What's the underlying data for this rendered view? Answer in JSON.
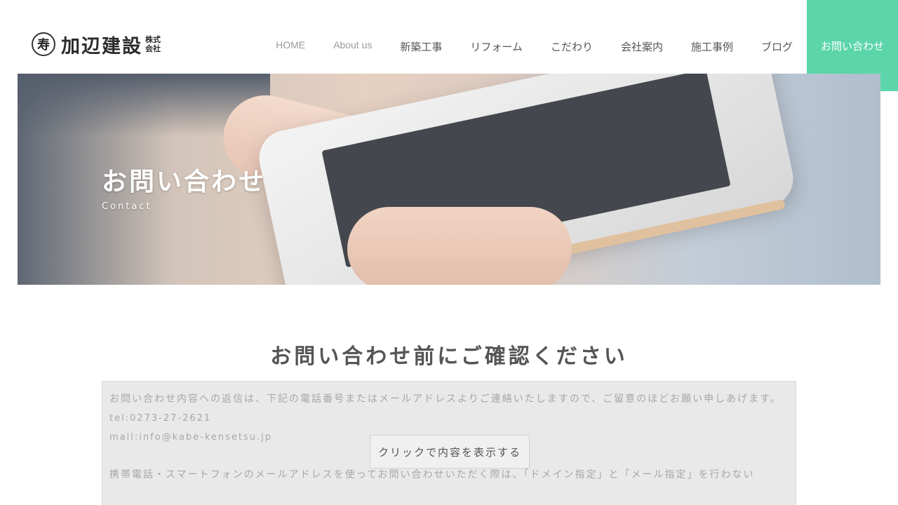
{
  "header": {
    "logo": {
      "seal": "寿",
      "name": "加辺建設",
      "suffix_top": "株式",
      "suffix_bottom": "会社"
    },
    "nav": [
      {
        "label": "HOME"
      },
      {
        "label": "About us"
      },
      {
        "label": "新築工事"
      },
      {
        "label": "リフォーム"
      },
      {
        "label": "こだわり"
      },
      {
        "label": "会社案内"
      },
      {
        "label": "施工事例"
      },
      {
        "label": "ブログ"
      }
    ],
    "cta_label": "お問い合わせ",
    "cta_color": "#5cd5aa"
  },
  "hero": {
    "title": "お問い合わせ",
    "subtitle": "Contact"
  },
  "main": {
    "section_title": "お問い合わせ前にご確認ください",
    "notice": {
      "line1": "お問い合わせ内容への返信は、下記の電話番号またはメールアドレスよりご連絡いたしますので、ご留意のほどお願い申しあげます。",
      "tel": "tel:0273-27-2621",
      "mail": "mail:info@kabe-kensetsu.jp",
      "line2": "携帯電話・スマートフォンのメールアドレスを使ってお問い合わせいただく際は、「ドメイン指定」と「メール指定」を行わない"
    },
    "reveal_button": "クリックで内容を表示する"
  }
}
